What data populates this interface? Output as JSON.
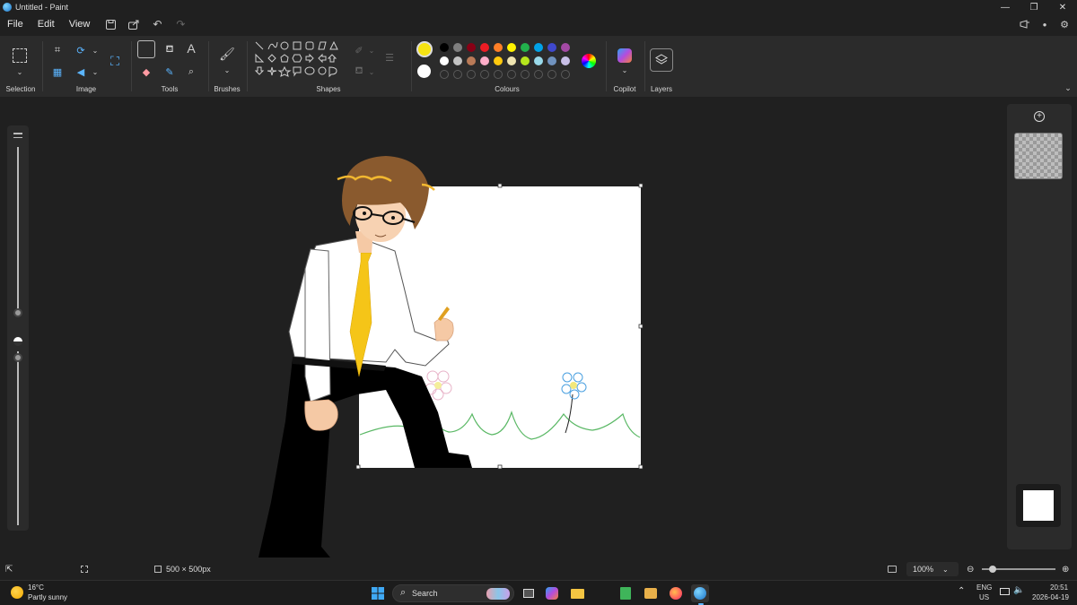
{
  "window": {
    "title": "Untitled - Paint"
  },
  "menu": {
    "file": "File",
    "edit": "Edit",
    "view": "View"
  },
  "ribbon": {
    "selection_label": "Selection",
    "image_label": "Image",
    "tools_label": "Tools",
    "brushes_label": "Brushes",
    "shapes_label": "Shapes",
    "colours_label": "Colours",
    "copilot_label": "Copilot",
    "layers_label": "Layers",
    "text_tool_glyph": "A"
  },
  "colours": {
    "primary": "#f6e312",
    "secondary": "#ffffff",
    "row1": [
      "#000000",
      "#7f7f7f",
      "#880015",
      "#ed1c24",
      "#ff7f27",
      "#fff200",
      "#22b14c",
      "#00a2e8",
      "#3f48cc",
      "#a349a4"
    ],
    "row2": [
      "#ffffff",
      "#c3c3c3",
      "#b97a57",
      "#ffaec9",
      "#ffc90e",
      "#efe4b0",
      "#b5e61d",
      "#99d9ea",
      "#7092be",
      "#c8bfe7"
    ]
  },
  "status": {
    "canvas_size": "500 × 500px",
    "zoom": "100%"
  },
  "taskbar": {
    "weather_temp": "16°C",
    "weather_desc": "Partly sunny",
    "search_placeholder": "Search",
    "lang": "ENG",
    "region": "US",
    "time": "20:51",
    "date": "2026-04-19"
  }
}
